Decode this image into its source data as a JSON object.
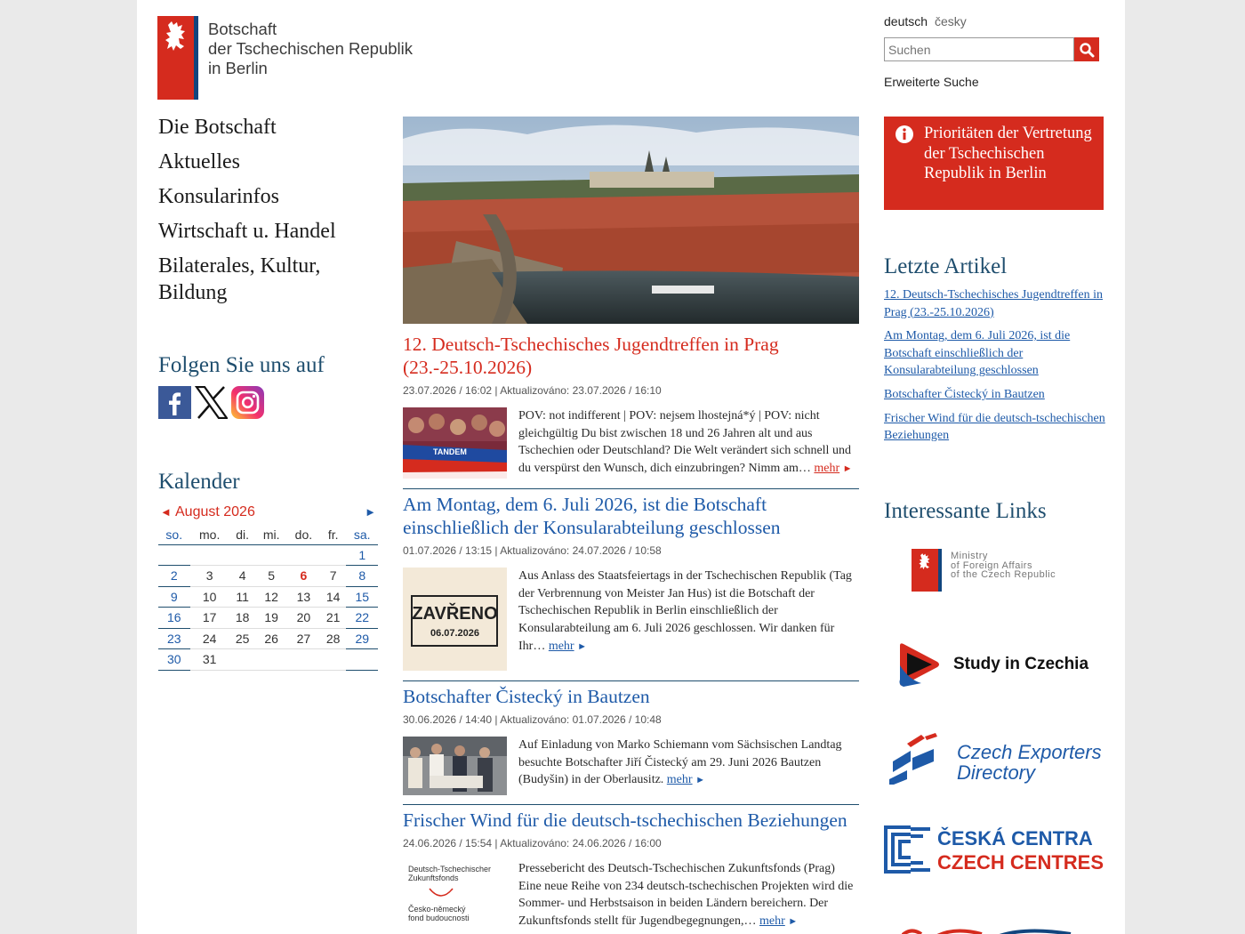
{
  "logo": {
    "line1": "Botschaft",
    "line2": "der Tschechischen Republik",
    "line3": "in Berlin"
  },
  "lang": {
    "current": "deutsch",
    "other": "česky"
  },
  "search": {
    "placeholder": "Suchen",
    "advanced": "Erweiterte Suche"
  },
  "nav": [
    "Die Botschaft",
    "Aktuelles",
    "Konsularinfos",
    "Wirtschaft u. Handel",
    "Bilaterales, Kultur, Bildung"
  ],
  "social": {
    "title": "Folgen Sie uns auf",
    "icons": [
      "facebook-icon",
      "x-icon",
      "instagram-icon"
    ]
  },
  "calendar": {
    "title": "Kalender",
    "month": "August 2026",
    "days": [
      "so.",
      "mo.",
      "di.",
      "mi.",
      "do.",
      "fr.",
      "sa."
    ],
    "today": "6",
    "weeks": [
      [
        "",
        "",
        "",
        "",
        "",
        "",
        "1"
      ],
      [
        "2",
        "3",
        "4",
        "5",
        "6",
        "7",
        "8"
      ],
      [
        "9",
        "10",
        "11",
        "12",
        "13",
        "14",
        "15"
      ],
      [
        "16",
        "17",
        "18",
        "19",
        "20",
        "21",
        "22"
      ],
      [
        "23",
        "24",
        "25",
        "26",
        "27",
        "28",
        "29"
      ],
      [
        "30",
        "31",
        "",
        "",
        "",
        "",
        ""
      ]
    ]
  },
  "articles": [
    {
      "title": "12. Deutsch-Tschechisches Jugendtreffen in Prag (23.-25.10.2026)",
      "meta": "23.07.2026 / 16:02 | Aktualizováno: 23.07.2026 / 16:10",
      "text": "POV: not indifferent | POV: nejsem lhostejná*ý | POV: nicht gleichgültig Du bist zwischen 18 und 26 Jahren alt und aus Tschechien oder Deutschland? Die Welt verändert sich schnell und du verspürst den Wunsch, dich einzubringen? Nimm am…",
      "more": "mehr",
      "thumb_label": "TANDEM"
    },
    {
      "title": "Am Montag, dem 6. Juli 2026, ist die Botschaft einschließlich der Konsularabteilung geschlossen",
      "meta": "01.07.2026 / 13:15 | Aktualizováno: 24.07.2026 / 10:58",
      "text": "Aus Anlass des Staatsfeiertags in der Tschechischen Republik (Tag der Verbrennung von Meister Jan Hus) ist die Botschaft der Tschechischen Republik in Berlin einschließlich der Konsularabteilung am 6. Juli 2026 geschlossen. Wir danken für Ihr…",
      "more": "mehr",
      "thumb_label": "ZAVŘENO",
      "thumb_date": "06.07.2026"
    },
    {
      "title": "Botschafter Čistecký in Bautzen",
      "meta": "30.06.2026 / 14:40 | Aktualizováno: 01.07.2026 / 10:48",
      "text": "Auf Einladung von Marko Schiemann vom Sächsischen Landtag besuchte Botschafter Jiří Čistecký am 29. Juni 2026 Bautzen (Budyšin) in der Oberlausitz.",
      "more": "mehr"
    },
    {
      "title": "Frischer Wind für die deutsch-tschechischen Beziehungen",
      "meta": "24.06.2026 / 15:54 | Aktualizováno: 24.06.2026 / 16:00",
      "text": "Pressebericht des Deutsch-Tschechischen Zukunftsfonds (Prag) Eine neue Reihe von 234 deutsch-tschechischen Projekten wird die Sommer- und Herbstsaison in beiden Ländern bereichern. Der Zukunftsfonds stellt für Jugendbegegnungen,…",
      "more": "mehr",
      "thumb_line1": "Deutsch-Tschechischer",
      "thumb_line2": "Zukunftsfonds",
      "thumb_line3": "Česko-německý",
      "thumb_line4": "fond budoucnosti"
    }
  ],
  "priority": "Prioritäten der Vertretung der Tschechischen Republik in Berlin",
  "recent": {
    "title": "Letzte Artikel",
    "items": [
      "12. Deutsch-Tschechisches Jugendtreffen in Prag (23.-25.10.2026)",
      "Am Montag, dem 6. Juli 2026, ist die Botschaft einschließlich der Konsularabteilung geschlossen",
      "Botschafter Čistecký in Bautzen",
      "Frischer Wind für die deutsch-tschechischen Beziehungen"
    ]
  },
  "links": {
    "title": "Interessante Links",
    "mfa": [
      "Ministry",
      "of Foreign Affairs",
      "of the Czech Republic"
    ],
    "study": "Study in Czechia",
    "exporters": [
      "Czech Exporters",
      "Directory"
    ],
    "centres": [
      "ČESKÁ CENTRA",
      "CZECH CENTRES"
    ]
  }
}
